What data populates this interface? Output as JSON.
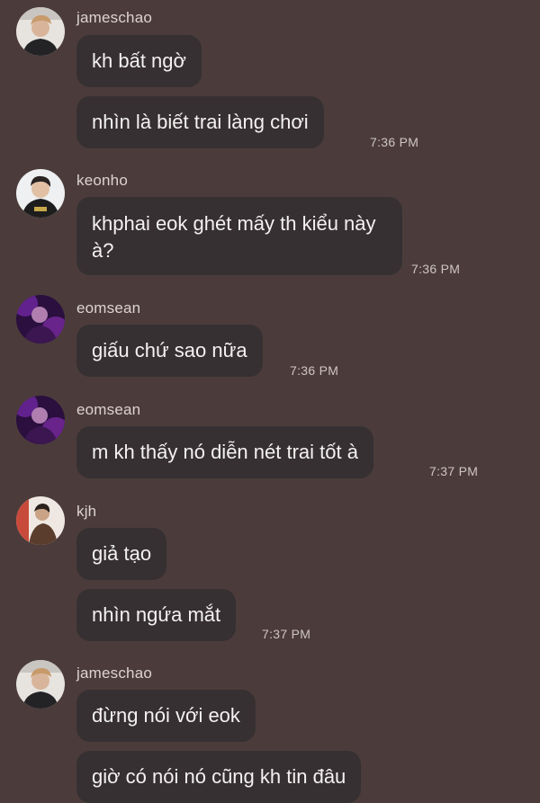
{
  "groups": [
    {
      "sender": "jameschao",
      "avatar_icon": "user-photo-icon",
      "messages": [
        "kh bất ngờ",
        "nhìn là biết trai làng chơi"
      ],
      "time": "7:36 PM"
    },
    {
      "sender": "keonho",
      "avatar_icon": "user-photo-icon",
      "messages": [
        "khphai eok ghét mấy th kiểu này à?"
      ],
      "time": "7:36 PM"
    },
    {
      "sender": "eomsean",
      "avatar_icon": "user-photo-icon",
      "messages": [
        "giấu chứ sao nữa"
      ],
      "time": "7:36 PM"
    },
    {
      "sender": "eomsean",
      "avatar_icon": "user-photo-icon",
      "messages": [
        "m kh thấy nó diễn nét trai tốt à"
      ],
      "time": "7:37 PM"
    },
    {
      "sender": "kjh",
      "avatar_icon": "user-photo-icon",
      "messages": [
        "giả tạo",
        "nhìn ngứa mắt"
      ],
      "time": "7:37 PM"
    },
    {
      "sender": "jameschao",
      "avatar_icon": "user-photo-icon",
      "messages": [
        "đừng nói với eok",
        "giờ có nói nó cũng kh tin đâu"
      ]
    }
  ],
  "colors": {
    "background": "#4b3c3b",
    "bubble": "#363032",
    "message_text": "#f4f1f1",
    "meta_text": "#cfc4c4"
  }
}
